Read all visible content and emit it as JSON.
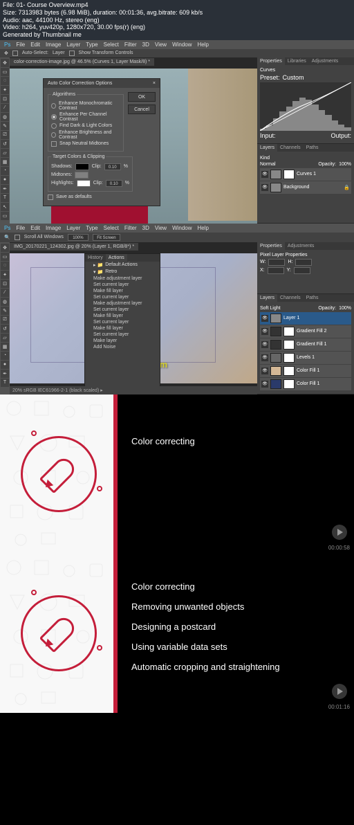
{
  "meta": {
    "l1": "File: 01- Course Overview.mp4",
    "l2": "Size: 7313983 bytes (6.98 MiB), duration: 00:01:36, avg.bitrate: 609 kb/s",
    "l3": "Audio: aac, 44100 Hz, stereo (eng)",
    "l4": "Video: h264, yuv420p, 1280x720, 30.00 fps(r) (eng)",
    "l5": "Generated by Thumbnail me"
  },
  "ps1": {
    "menu": [
      "File",
      "Edit",
      "Image",
      "Layer",
      "Type",
      "Select",
      "Filter",
      "3D",
      "View",
      "Window",
      "Help"
    ],
    "opt_label": "Auto-Select:",
    "opt_layer": "Layer",
    "opt_transform": "Show Transform Controls",
    "tab": "color-correction-image.jpg @ 46.5% (Curves 1, Layer Mask/8) *",
    "dialog": {
      "title": "Auto Color Correction Options",
      "close": "×",
      "algorithms": "Algorithms",
      "a1": "Enhance Monochromatic Contrast",
      "a2": "Enhance Per Channel Contrast",
      "a3": "Find Dark & Light Colors",
      "a4": "Enhance Brightness and Contrast",
      "snap": "Snap Neutral Midtones",
      "targets": "Target Colors & Clipping",
      "shadows": "Shadows:",
      "midtones": "Midtones:",
      "highlights": "Highlights:",
      "clip": "Clip:",
      "clipv": "0.10",
      "pct": "%",
      "save": "Save as defaults",
      "ok": "OK",
      "cancel": "Cancel"
    },
    "panels": {
      "properties": "Properties",
      "libraries": "Libraries",
      "adjustments": "Adjustments",
      "curves": "Curves",
      "preset": "Preset:",
      "custom": "Custom",
      "input": "Input:",
      "output": "Output:",
      "layers": "Layers",
      "channels": "Channels",
      "paths": "Paths",
      "kind": "Kind",
      "normal": "Normal",
      "opacity": "Opacity:",
      "opv": "100%",
      "curves1": "Curves 1",
      "background": "Background"
    }
  },
  "ps2": {
    "menu": [
      "File",
      "Edit",
      "Image",
      "Layer",
      "Type",
      "Select",
      "Filter",
      "3D",
      "View",
      "Window",
      "Help"
    ],
    "scroll": "Scroll All Windows",
    "zoom": "100%",
    "fit": "Fit Screen",
    "tab": "IMG_20170221_124302.jpg @ 20% (Layer 1, RGB/8*) *",
    "watermark": "www.cg-ku.com",
    "actions": {
      "title": "Actions",
      "history": "History",
      "items": [
        "Default Actions",
        "Retro",
        "Make adjustment layer",
        "Set current layer",
        "Make fill layer",
        "Set current layer",
        "Make adjustment layer",
        "Set current layer",
        "Make fill layer",
        "Set current layer",
        "Make fill layer",
        "Set current layer",
        "Make layer",
        "Add Noise"
      ]
    },
    "props": {
      "title": "Properties",
      "adj": "Adjustments",
      "pll": "Pixel Layer Properties",
      "w": "W:",
      "h": "H:",
      "x": "X:",
      "y": "Y:"
    },
    "layers": {
      "tab1": "Layers",
      "tab2": "Channels",
      "tab3": "Paths",
      "softlight": "Soft Light",
      "opacity": "Opacity:",
      "opv": "100%",
      "items": [
        "Layer 1",
        "Gradient Fill 2",
        "Gradient Fill 1",
        "Levels 1",
        "Color Fill 1",
        "Color Fill 1"
      ]
    },
    "status": "20%    sRGB IEC61966-2-1 (black scaled) ▸"
  },
  "slide1": {
    "t1": "Color correcting",
    "ts": "00:00:58"
  },
  "slide2": {
    "t1": "Color correcting",
    "t2": "Removing unwanted objects",
    "t3": "Designing a postcard",
    "t4": "Using variable data sets",
    "t5": "Automatic cropping and straightening",
    "ts": "00:01:16"
  }
}
